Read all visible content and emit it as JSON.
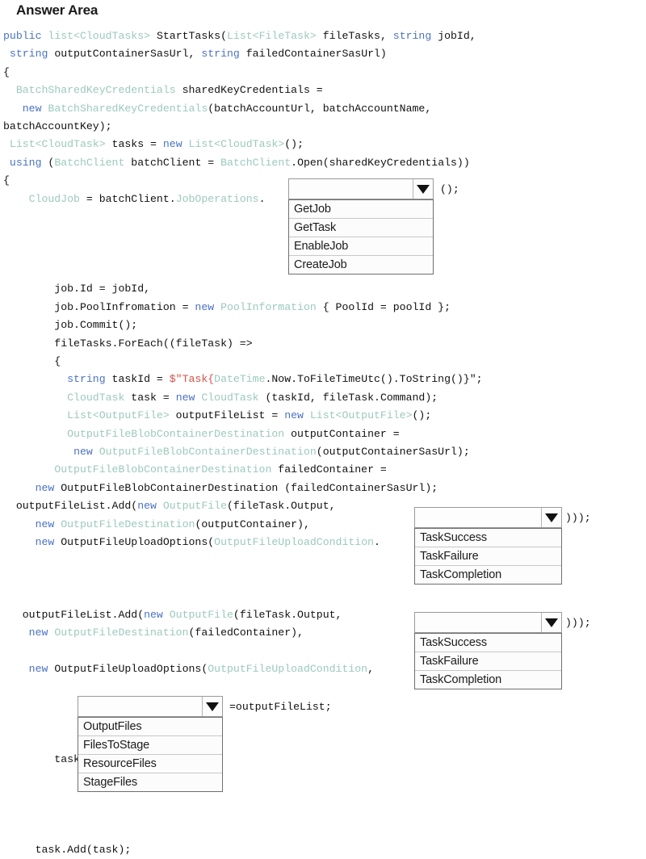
{
  "header": {
    "title": "Answer Area"
  },
  "code": {
    "lines": [
      [
        {
          "t": "public ",
          "c": "kw"
        },
        {
          "t": "list<CloudTasks> ",
          "c": "typ"
        },
        {
          "t": "StartTasks(",
          "c": "pl"
        },
        {
          "t": "List<FileTask>",
          "c": "typ"
        },
        {
          "t": " fileTasks, ",
          "c": "pl"
        },
        {
          "t": "string",
          "c": "kw"
        },
        {
          "t": " jobId,",
          "c": "pl"
        }
      ],
      [
        {
          "t": " ",
          "c": "pl"
        },
        {
          "t": "string",
          "c": "kw"
        },
        {
          "t": " outputContainerSasUrl, ",
          "c": "pl"
        },
        {
          "t": "string",
          "c": "kw"
        },
        {
          "t": " failedContainerSasUrl)",
          "c": "pl"
        }
      ],
      [
        {
          "t": "{",
          "c": "pl"
        }
      ],
      [
        {
          "t": "  ",
          "c": "pl"
        },
        {
          "t": "BatchSharedKeyCredentials",
          "c": "typ"
        },
        {
          "t": " sharedKeyCredentials =",
          "c": "pl"
        }
      ],
      [
        {
          "t": "   ",
          "c": "pl"
        },
        {
          "t": "new ",
          "c": "kw"
        },
        {
          "t": "BatchSharedKeyCredentials",
          "c": "typ"
        },
        {
          "t": "(batchAccountUrl, batchAccountName,",
          "c": "pl"
        }
      ],
      [
        {
          "t": "batchAccountKey);",
          "c": "pl"
        }
      ],
      [
        {
          "t": " ",
          "c": "pl"
        },
        {
          "t": "List<CloudTask>",
          "c": "typ"
        },
        {
          "t": " tasks = ",
          "c": "pl"
        },
        {
          "t": "new ",
          "c": "kw"
        },
        {
          "t": "List<CloudTask>",
          "c": "typ"
        },
        {
          "t": "();",
          "c": "pl"
        }
      ],
      [
        {
          "t": " ",
          "c": "pl"
        },
        {
          "t": "using ",
          "c": "kw"
        },
        {
          "t": "(",
          "c": "pl"
        },
        {
          "t": "BatchClient",
          "c": "typ"
        },
        {
          "t": " batchClient = ",
          "c": "pl"
        },
        {
          "t": "BatchClient",
          "c": "typ"
        },
        {
          "t": ".Open(sharedKeyCredentials))",
          "c": "pl"
        }
      ],
      [
        {
          "t": "{",
          "c": "pl"
        }
      ],
      [
        {
          "t": "    ",
          "c": "pl"
        },
        {
          "t": "CloudJob",
          "c": "typ"
        },
        {
          "t": " = batchClient.",
          "c": "pl"
        },
        {
          "t": "JobOperations",
          "c": "typ"
        },
        {
          "t": ".",
          "c": "pl"
        }
      ],
      [
        {
          "t": "",
          "c": "pl"
        }
      ],
      [
        {
          "t": "",
          "c": "pl"
        }
      ],
      [
        {
          "t": "",
          "c": "pl"
        }
      ],
      [
        {
          "t": "",
          "c": "pl"
        }
      ],
      [
        {
          "t": "        job.Id = jobId,",
          "c": "pl"
        }
      ],
      [
        {
          "t": "        job.PoolInfromation = ",
          "c": "pl"
        },
        {
          "t": "new ",
          "c": "kw"
        },
        {
          "t": "PoolInformation",
          "c": "typ"
        },
        {
          "t": " { PoolId = poolId };",
          "c": "pl"
        }
      ],
      [
        {
          "t": "        job.Commit();",
          "c": "pl"
        }
      ],
      [
        {
          "t": "        fileTasks.ForEach((fileTask) =>",
          "c": "pl"
        }
      ],
      [
        {
          "t": "        {",
          "c": "pl"
        }
      ],
      [
        {
          "t": "          ",
          "c": "pl"
        },
        {
          "t": "string",
          "c": "kw"
        },
        {
          "t": " taskId = ",
          "c": "pl"
        },
        {
          "t": "$\"Task{",
          "c": "str"
        },
        {
          "t": "DateTime",
          "c": "typ"
        },
        {
          "t": ".Now.ToFileTimeUtc().ToString()}\";",
          "c": "pl"
        }
      ],
      [
        {
          "t": "          ",
          "c": "pl"
        },
        {
          "t": "CloudTask",
          "c": "typ"
        },
        {
          "t": " task = ",
          "c": "pl"
        },
        {
          "t": "new ",
          "c": "kw"
        },
        {
          "t": "CloudTask",
          "c": "typ"
        },
        {
          "t": " (taskId, fileTask.Command);",
          "c": "pl"
        }
      ],
      [
        {
          "t": "          ",
          "c": "pl"
        },
        {
          "t": "List<OutputFile>",
          "c": "typ"
        },
        {
          "t": " outputFileList = ",
          "c": "pl"
        },
        {
          "t": "new ",
          "c": "kw"
        },
        {
          "t": "List<OutputFile>",
          "c": "typ"
        },
        {
          "t": "();",
          "c": "pl"
        }
      ],
      [
        {
          "t": "          ",
          "c": "pl"
        },
        {
          "t": "OutputFileBlobContainerDestination",
          "c": "typ"
        },
        {
          "t": " outputContainer =",
          "c": "pl"
        }
      ],
      [
        {
          "t": "           ",
          "c": "pl"
        },
        {
          "t": "new ",
          "c": "kw"
        },
        {
          "t": "OutputFileBlobContainerDestination",
          "c": "typ"
        },
        {
          "t": "(outputContainerSasUrl);",
          "c": "pl"
        }
      ],
      [
        {
          "t": "        ",
          "c": "pl"
        },
        {
          "t": "OutputFileBlobContainerDestination",
          "c": "typ"
        },
        {
          "t": " failedContainer =",
          "c": "pl"
        }
      ],
      [
        {
          "t": "     ",
          "c": "pl"
        },
        {
          "t": "new ",
          "c": "kw"
        },
        {
          "t": "OutputFileBlobContainerDestination (failedContainerSasUrl);",
          "c": "pl"
        }
      ],
      [
        {
          "t": "  outputFileList.Add(",
          "c": "pl"
        },
        {
          "t": "new ",
          "c": "kw"
        },
        {
          "t": "OutputFile",
          "c": "typ"
        },
        {
          "t": "(fileTask.Output,",
          "c": "pl"
        }
      ],
      [
        {
          "t": "     ",
          "c": "pl"
        },
        {
          "t": "new ",
          "c": "kw"
        },
        {
          "t": "OutputFileDestination",
          "c": "typ"
        },
        {
          "t": "(outputContainer),",
          "c": "pl"
        }
      ],
      [
        {
          "t": "     ",
          "c": "pl"
        },
        {
          "t": "new ",
          "c": "kw"
        },
        {
          "t": "OutputFileUploadOptions(",
          "c": "pl"
        },
        {
          "t": "OutputFileUploadCondition",
          "c": "typ"
        },
        {
          "t": ".",
          "c": "pl"
        }
      ],
      [
        {
          "t": "",
          "c": "pl"
        }
      ],
      [
        {
          "t": "",
          "c": "pl"
        }
      ],
      [
        {
          "t": "",
          "c": "pl"
        }
      ],
      [
        {
          "t": "   outputFileList.Add(",
          "c": "pl"
        },
        {
          "t": "new ",
          "c": "kw"
        },
        {
          "t": "OutputFile",
          "c": "typ"
        },
        {
          "t": "(fileTask.Output,",
          "c": "pl"
        }
      ],
      [
        {
          "t": "    ",
          "c": "pl"
        },
        {
          "t": "new ",
          "c": "kw"
        },
        {
          "t": "OutputFileDestination",
          "c": "typ"
        },
        {
          "t": "(failedContainer),",
          "c": "pl"
        }
      ],
      [
        {
          "t": "",
          "c": "pl"
        }
      ],
      [
        {
          "t": "    ",
          "c": "pl"
        },
        {
          "t": "new ",
          "c": "kw"
        },
        {
          "t": "OutputFileUploadOptions(",
          "c": "pl"
        },
        {
          "t": "OutputFileUploadCondition",
          "c": "typ"
        },
        {
          "t": ",",
          "c": "pl"
        }
      ],
      [
        {
          "t": "",
          "c": "pl"
        }
      ],
      [
        {
          "t": "",
          "c": "pl"
        }
      ],
      [
        {
          "t": "",
          "c": "pl"
        }
      ],
      [
        {
          "t": "",
          "c": "pl"
        }
      ],
      [
        {
          "t": "        task ",
          "c": "pl"
        }
      ],
      [
        {
          "t": "",
          "c": "pl"
        }
      ],
      [
        {
          "t": "",
          "c": "pl"
        }
      ],
      [
        {
          "t": "",
          "c": "pl"
        }
      ],
      [
        {
          "t": "",
          "c": "pl"
        }
      ],
      [
        {
          "t": "     task.Add(task);",
          "c": "pl"
        }
      ]
    ]
  },
  "dropdowns": [
    {
      "id": "job-operation",
      "value": "",
      "arrow_icon": "chevron-down-icon",
      "trailing_code": "();",
      "options": [
        "GetJob",
        "GetTask",
        "EnableJob",
        "CreateJob"
      ]
    },
    {
      "id": "upload-condition-output",
      "value": "",
      "arrow_icon": "chevron-down-icon",
      "trailing_code": ")));",
      "options": [
        "TaskSuccess",
        "TaskFailure",
        "TaskCompletion"
      ]
    },
    {
      "id": "upload-condition-failed",
      "value": "",
      "arrow_icon": "chevron-down-icon",
      "trailing_code": ")));",
      "options": [
        "TaskSuccess",
        "TaskFailure",
        "TaskCompletion"
      ]
    },
    {
      "id": "task-property",
      "value": "",
      "arrow_icon": "chevron-down-icon",
      "trailing_code": "=outputFileList;",
      "options": [
        "OutputFiles",
        "FilesToStage",
        "ResourceFiles",
        "StageFiles"
      ]
    }
  ],
  "colors": {
    "keyword": "#4a72c4",
    "type": "#9bc9bd",
    "string": "#d6504a",
    "plain": "#111111",
    "dropdown_border": "#6f6f6f",
    "background": "#ffffff"
  }
}
